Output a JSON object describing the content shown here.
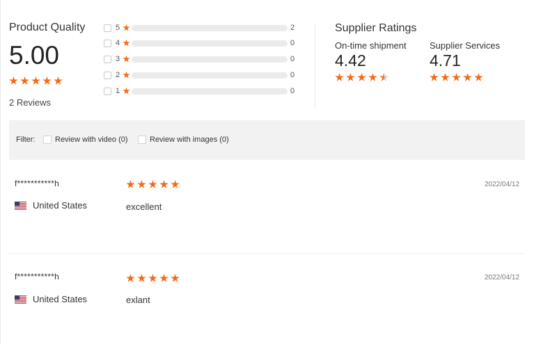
{
  "product_quality": {
    "title": "Product Quality",
    "score": "5.00",
    "stars": 5,
    "reviews_count": "2 Reviews",
    "histogram": [
      {
        "stars": "5",
        "count": "2",
        "fraction": 1.0
      },
      {
        "stars": "4",
        "count": "0",
        "fraction": 0
      },
      {
        "stars": "3",
        "count": "0",
        "fraction": 0
      },
      {
        "stars": "2",
        "count": "0",
        "fraction": 0
      },
      {
        "stars": "1",
        "count": "0",
        "fraction": 0
      }
    ]
  },
  "supplier_ratings": {
    "title": "Supplier Ratings",
    "items": [
      {
        "label": "On-time shipment",
        "value": "4.42",
        "stars": 4.5
      },
      {
        "label": "Supplier Services",
        "value": "4.71",
        "stars": 5
      }
    ]
  },
  "filter": {
    "label": "Filter:",
    "options": [
      {
        "label": "Review with video (0)",
        "checked": false
      },
      {
        "label": "Review with images (0)",
        "checked": false
      }
    ]
  },
  "reviews": [
    {
      "user": "f***********h",
      "country": "United States",
      "stars": 5,
      "text": "excellent",
      "date": "2022/04/12"
    },
    {
      "user": "f***********h",
      "country": "United States",
      "stars": 5,
      "text": "exlant",
      "date": "2022/04/12"
    }
  ],
  "colors": {
    "accent": "#f36b16",
    "bar_track": "#ebebeb",
    "filter_bg": "#f2f2f2"
  }
}
